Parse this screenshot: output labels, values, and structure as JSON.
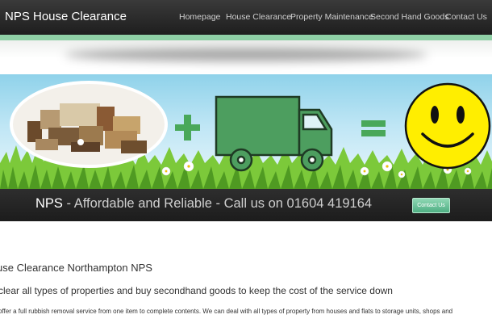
{
  "header": {
    "brand": "NPS House Clearance",
    "nav": [
      "Homepage",
      "House Clearance",
      "Property Maintenance",
      "Second Hand Goods",
      "Contact Us"
    ]
  },
  "banner": {
    "cta_brand": "NPS",
    "cta_rest": " - Affordable and Reliable - Call us on 01604 419164",
    "contact_button": "Contact Us"
  },
  "content": {
    "title": "use Clearance Northampton NPS",
    "subtitle": "clear all types of properties and buy secondhand goods to keep the cost of the service down",
    "body": "offer a full rubbish removal service from one item to complete contents. We can deal with all types of property from houses and flats to storage units, shops and"
  },
  "colors": {
    "header_bg": "#262626",
    "accent_green": "#8fd0a6",
    "truck_green": "#4d9e5f",
    "smiley_yellow": "#ffee00"
  }
}
